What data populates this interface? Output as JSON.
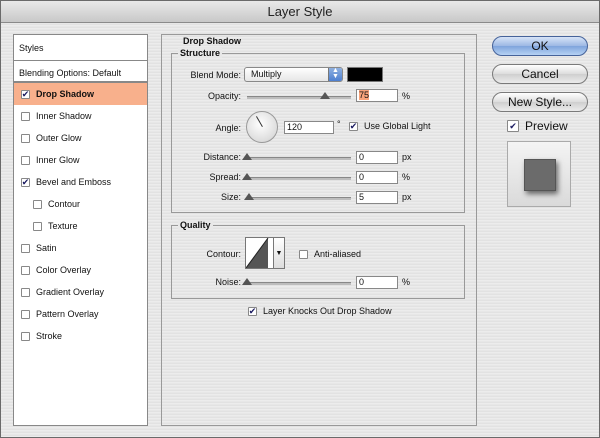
{
  "window": {
    "title": "Layer Style"
  },
  "styles_list": {
    "header": "Styles",
    "blending_options": "Blending Options: Default",
    "items": [
      {
        "label": "Drop Shadow",
        "checked": true,
        "selected": true,
        "sub": false
      },
      {
        "label": "Inner Shadow",
        "checked": false,
        "selected": false,
        "sub": false
      },
      {
        "label": "Outer Glow",
        "checked": false,
        "selected": false,
        "sub": false
      },
      {
        "label": "Inner Glow",
        "checked": false,
        "selected": false,
        "sub": false
      },
      {
        "label": "Bevel and Emboss",
        "checked": true,
        "selected": false,
        "sub": false
      },
      {
        "label": "Contour",
        "checked": false,
        "selected": false,
        "sub": true
      },
      {
        "label": "Texture",
        "checked": false,
        "selected": false,
        "sub": true
      },
      {
        "label": "Satin",
        "checked": false,
        "selected": false,
        "sub": false
      },
      {
        "label": "Color Overlay",
        "checked": false,
        "selected": false,
        "sub": false
      },
      {
        "label": "Gradient Overlay",
        "checked": false,
        "selected": false,
        "sub": false
      },
      {
        "label": "Pattern Overlay",
        "checked": false,
        "selected": false,
        "sub": false
      },
      {
        "label": "Stroke",
        "checked": false,
        "selected": false,
        "sub": false
      }
    ]
  },
  "drop_shadow": {
    "section_title": "Drop Shadow",
    "structure": {
      "title": "Structure",
      "blend_mode_label": "Blend Mode:",
      "blend_mode_value": "Multiply",
      "shadow_color": "#000000",
      "opacity_label": "Opacity:",
      "opacity_value": "75",
      "opacity_unit": "%",
      "opacity_level": 75,
      "angle_label": "Angle:",
      "angle_value": "120",
      "angle_unit": "°",
      "use_global_light_label": "Use Global Light",
      "use_global_light": true,
      "distance_label": "Distance:",
      "distance_value": "0",
      "distance_unit": "px",
      "distance_level": 0,
      "spread_label": "Spread:",
      "spread_value": "0",
      "spread_unit": "%",
      "spread_level": 0,
      "size_label": "Size:",
      "size_value": "5",
      "size_unit": "px",
      "size_level": 2
    },
    "quality": {
      "title": "Quality",
      "contour_label": "Contour:",
      "anti_aliased_label": "Anti-aliased",
      "anti_aliased": false,
      "noise_label": "Noise:",
      "noise_value": "0",
      "noise_unit": "%",
      "noise_level": 0
    },
    "knocks_out_label": "Layer Knocks Out Drop Shadow",
    "knocks_out": true
  },
  "buttons": {
    "ok": "OK",
    "cancel": "Cancel",
    "new_style": "New Style...",
    "preview_label": "Preview",
    "preview_checked": true
  },
  "colors": {
    "selected_row": "#f8b08c",
    "opacity_highlight": "#f8a37b",
    "default_button": "#7fa4dc"
  }
}
